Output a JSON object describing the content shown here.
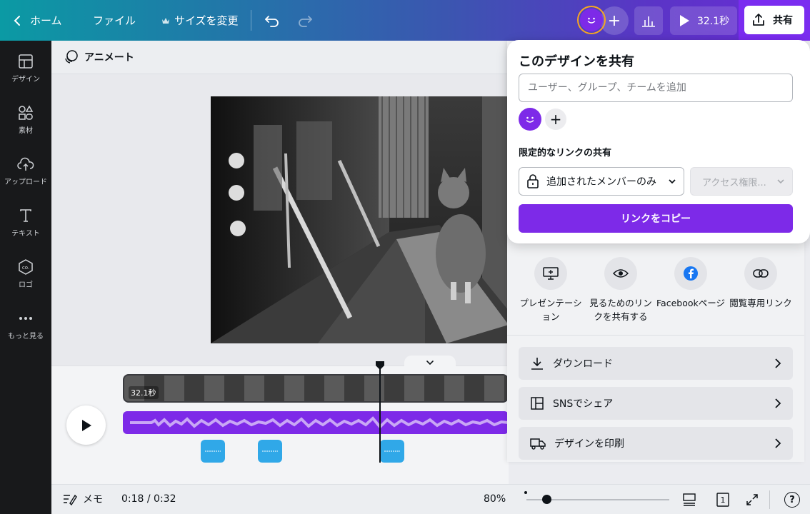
{
  "topbar": {
    "home_label": "ホーム",
    "file_label": "ファイル",
    "resize_label": "サイズを変更",
    "plus_label": "+",
    "duration_label": "32.1秒",
    "share_label": "共有"
  },
  "rail": {
    "items": [
      {
        "label": "デザイン",
        "icon": "layout-icon"
      },
      {
        "label": "素材",
        "icon": "shapes-icon"
      },
      {
        "label": "アップロード",
        "icon": "cloud-upload-icon"
      },
      {
        "label": "テキスト",
        "icon": "text-icon"
      },
      {
        "label": "ロゴ",
        "icon": "logo-icon"
      },
      {
        "label": "もっと見る",
        "icon": "more-icon"
      }
    ]
  },
  "canvas": {
    "header_label": "アニメート"
  },
  "timeline": {
    "video_duration": "32.1秒"
  },
  "bottombar": {
    "notes_label": "メモ",
    "time_readout": "0:18 / 0:32",
    "zoom_label": "80%",
    "page_count": "1",
    "help_label": "?"
  },
  "share_panel": {
    "title": "このデザインを共有",
    "invite_placeholder": "ユーザー、グループ、チームを追加",
    "add_label": "+",
    "link_section_title": "限定的なリンクの共有",
    "access_select": "追加されたメンバーのみ",
    "permission_select": "アクセス権限...",
    "copy_link_label": "リンクをコピー",
    "options": [
      {
        "label": "プレゼンテーション",
        "icon": "present-icon"
      },
      {
        "label": "見るためのリンクを共有する",
        "icon": "eye-icon"
      },
      {
        "label": "Facebookページ",
        "icon": "facebook-icon"
      },
      {
        "label": "閲覧専用リンク",
        "icon": "link-icon"
      }
    ],
    "rows": [
      {
        "label": "ダウンロード",
        "icon": "download-icon"
      },
      {
        "label": "SNSでシェア",
        "icon": "social-icon"
      },
      {
        "label": "デザインを印刷",
        "icon": "print-truck-icon"
      }
    ]
  },
  "colors": {
    "brand_purple": "#7d2ae8",
    "beat_blue": "#30a8e8",
    "avatar_ring": "#f5a623"
  }
}
